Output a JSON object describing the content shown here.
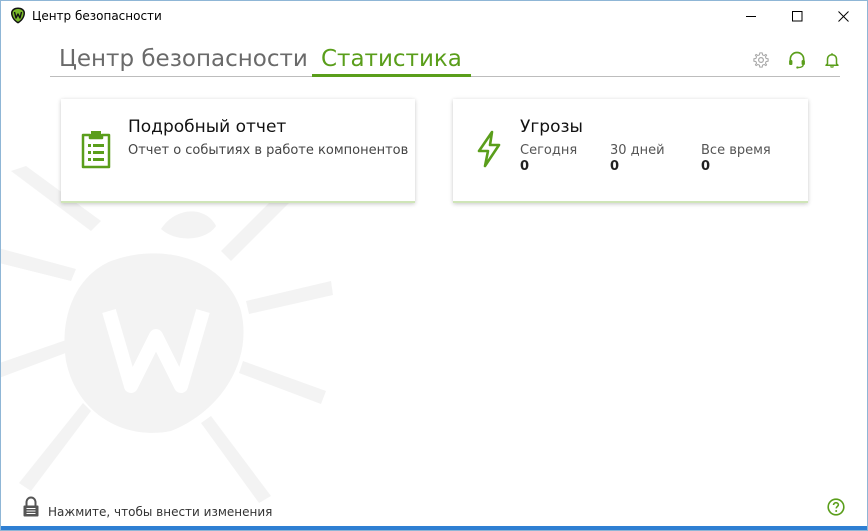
{
  "window": {
    "title": "Центр безопасности",
    "controls": {
      "minimize": "minimize-icon",
      "maximize": "maximize-icon",
      "close": "close-icon"
    }
  },
  "tabs": [
    {
      "label": "Центр безопасности",
      "active": false
    },
    {
      "label": "Статистика",
      "active": true
    }
  ],
  "header_icons": [
    "gear-icon",
    "support-headset-icon",
    "bell-icon"
  ],
  "cards": {
    "report": {
      "title": "Подробный отчет",
      "description": "Отчет о событиях в работе компонентов",
      "icon": "clipboard-icon"
    },
    "threats": {
      "title": "Угрозы",
      "icon": "lightning-icon",
      "stats": [
        {
          "label": "Сегодня",
          "value": "0"
        },
        {
          "label": "30 дней",
          "value": "0"
        },
        {
          "label": "Все время",
          "value": "0"
        }
      ]
    }
  },
  "footer": {
    "lock_text": "Нажмите, чтобы внести изменения",
    "help_icon": "help-icon"
  },
  "colors": {
    "accent": "#5a9e1b",
    "tab_inactive": "#6a6a6a",
    "icon_gray": "#a8a8a8"
  }
}
